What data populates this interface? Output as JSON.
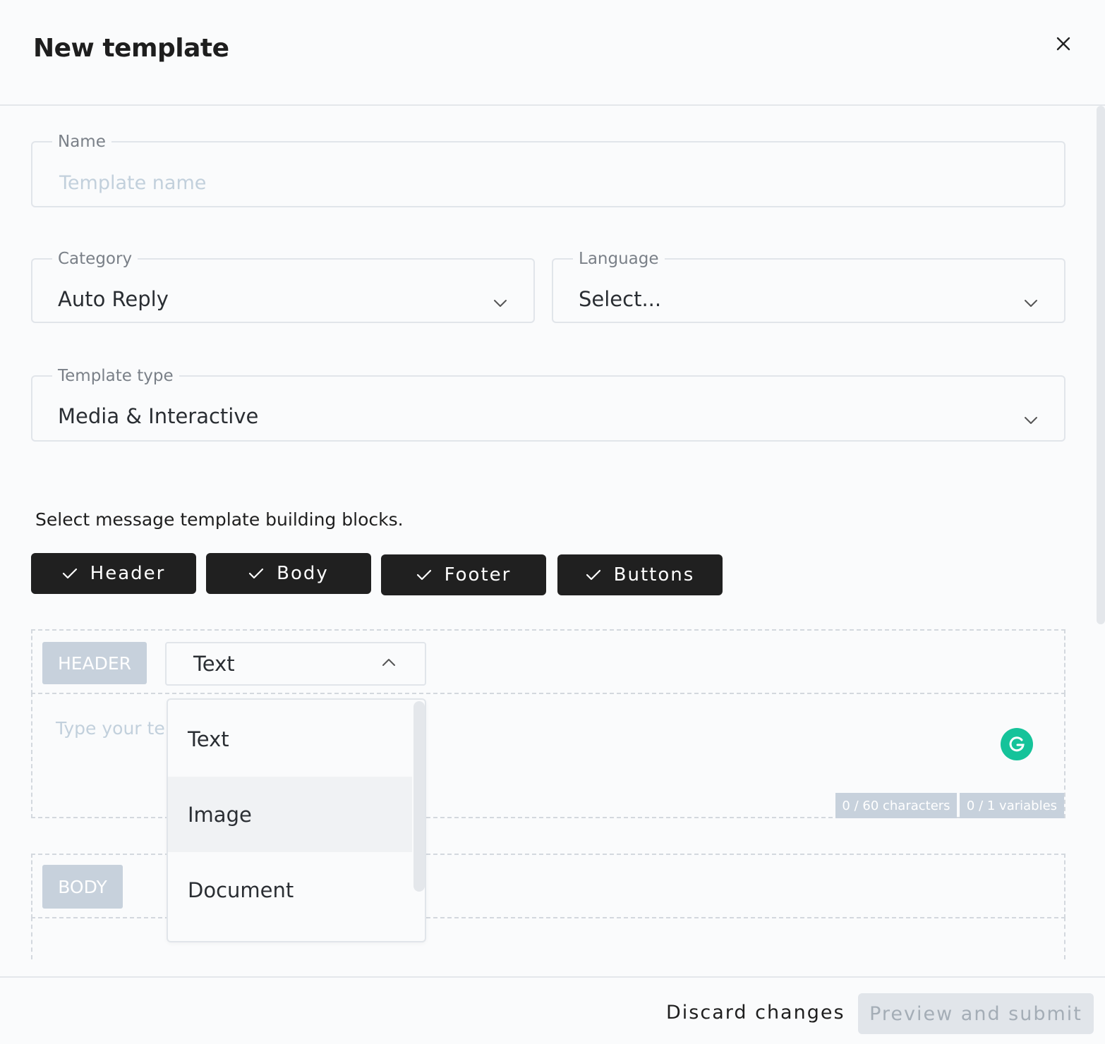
{
  "dialog": {
    "title": "New template"
  },
  "form": {
    "name": {
      "label": "Name",
      "placeholder": "Template name",
      "value": ""
    },
    "category": {
      "label": "Category",
      "value": "Auto Reply"
    },
    "language": {
      "label": "Language",
      "value": "Select..."
    },
    "template_type": {
      "label": "Template type",
      "value": "Media & Interactive"
    }
  },
  "blocks": {
    "prompt": "Select message template building blocks.",
    "chips": [
      {
        "label": "Header",
        "checked": true
      },
      {
        "label": "Body",
        "checked": true
      },
      {
        "label": "Footer",
        "checked": true
      },
      {
        "label": "Buttons",
        "checked": true
      }
    ]
  },
  "header_section": {
    "tag": "HEADER",
    "format_select": {
      "value": "Text",
      "open": true
    },
    "text_placeholder": "Type your tem",
    "char_counter": "0 / 60 characters",
    "var_counter": "0 / 1 variables"
  },
  "format_dropdown": {
    "options": [
      "Text",
      "Image",
      "Document"
    ],
    "highlighted": "Image"
  },
  "body_section": {
    "tag": "BODY"
  },
  "footer": {
    "discard_label": "Discard changes",
    "submit_label": "Preview and submit"
  },
  "colors": {
    "chip_bg": "#202020",
    "tag_bg": "#c7d1dc",
    "grammarly": "#15c39a",
    "submit_disabled_bg": "#e1e5ea"
  },
  "icons": {
    "close": "close-icon",
    "chevron_down": "chevron-down-icon",
    "chevron_up": "chevron-up-icon",
    "check": "check-icon",
    "grammarly": "grammarly-icon"
  }
}
